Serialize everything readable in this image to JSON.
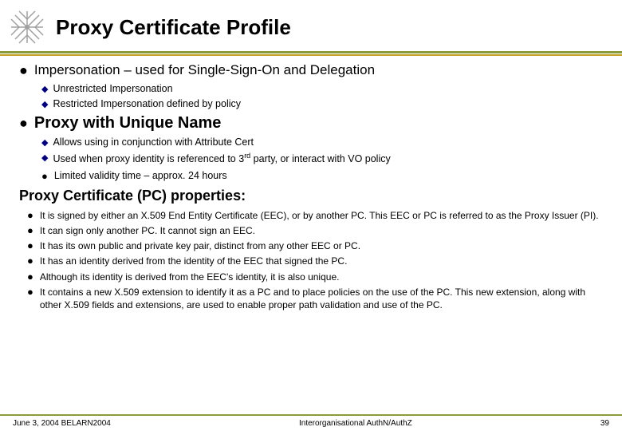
{
  "header": {
    "title": "Proxy Certificate Profile"
  },
  "bullets": {
    "bullet1": {
      "main": "Impersonation – used for Single-Sign-On and Delegation",
      "sub": [
        "Unrestricted Impersonation",
        "Restricted Impersonation defined by policy"
      ]
    },
    "bullet2": {
      "main": "Proxy with Unique Name",
      "sub": [
        "Allows using in conjunction with Attribute Cert",
        "Used when proxy identity is referenced to 3rd party, or interact with VO policy"
      ],
      "extra": "Limited validity time – approx. 24 hours"
    }
  },
  "pc_section": {
    "title": "Proxy Certificate (PC) properties:",
    "items": [
      "It is signed by either an X.509 End Entity Certificate (EEC), or by another PC. This EEC or PC is referred to as the Proxy Issuer (PI).",
      "It can sign only another PC. It cannot sign an EEC.",
      "It has its own public and private key pair, distinct from any other EEC or PC.",
      "It has an identity derived from the identity of the EEC that signed the PC.",
      "Although its identity is derived from the EEC's identity, it is also unique.",
      "It contains a new X.509 extension to identify it as a PC and to place policies on the use of the PC. This new extension, along with other X.509 fields and extensions, are used to enable proper path validation and use of the PC."
    ]
  },
  "footer": {
    "left": "June 3, 2004 BELARN2004",
    "center": "Interorganisational AuthN/AuthZ",
    "right": "39"
  }
}
